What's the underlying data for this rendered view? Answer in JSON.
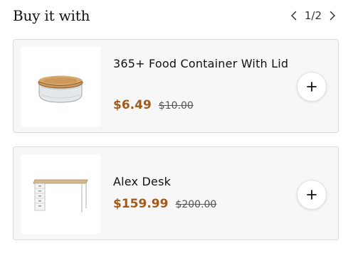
{
  "section": {
    "title": "Buy it with",
    "pager": {
      "current": "1",
      "total": "2",
      "separator": "/",
      "prev_icon": "chevron-left-icon",
      "next_icon": "chevron-right-icon"
    }
  },
  "products": [
    {
      "name": "365+ Food Container With Lid",
      "price": "$6.49",
      "old_price": "$10.00",
      "image_icon": "food-container-image",
      "add_icon": "plus-icon"
    },
    {
      "name": "Alex Desk",
      "price": "$159.99",
      "old_price": "$200.00",
      "image_icon": "desk-image",
      "add_icon": "plus-icon"
    }
  ],
  "colors": {
    "price": "#a05a1c",
    "card_bg": "#f7f7f7",
    "card_border": "#dcdcdc"
  }
}
